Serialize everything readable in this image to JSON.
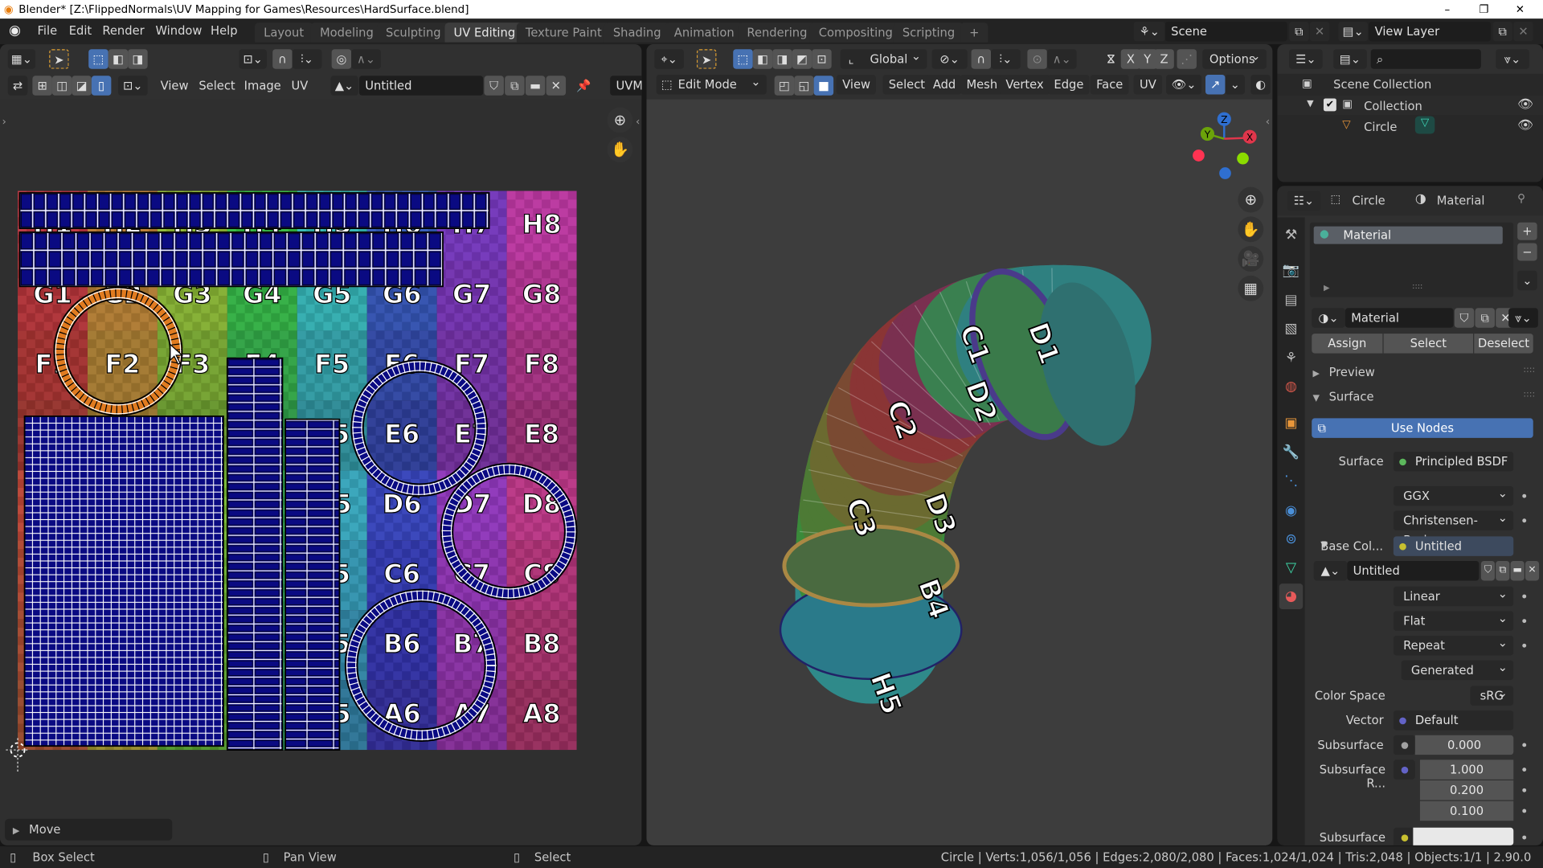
{
  "window": {
    "title": "Blender* [Z:\\FlippedNormals\\UV Mapping for Games\\Resources\\HardSurface.blend]",
    "minimize": "–",
    "maximize": "❐",
    "close": "✕"
  },
  "topbar": {
    "menus": [
      "File",
      "Edit",
      "Render",
      "Window",
      "Help"
    ],
    "tabs": [
      "Layout",
      "Modeling",
      "Sculpting",
      "UV Editing",
      "Texture Paint",
      "Shading",
      "Animation",
      "Rendering",
      "Compositing",
      "Scripting"
    ],
    "active_tab": "UV Editing",
    "add_tab": "+",
    "scene": "Scene",
    "view_layer": "View Layer"
  },
  "uv_editor": {
    "menus": [
      "View",
      "Select",
      "Image",
      "UV"
    ],
    "image_name": "Untitled",
    "uvmap_label": "UVMa",
    "uv_grid": {
      "rows": [
        "H",
        "G",
        "F",
        "E",
        "D",
        "C",
        "B",
        "A"
      ],
      "cols": [
        "1",
        "2",
        "3",
        "4",
        "5",
        "6",
        "7",
        "8"
      ]
    },
    "island_color": "#0a0a82",
    "selected_island_color": "#e07b20",
    "last_operator": "Move"
  },
  "viewport": {
    "orientation": "Global",
    "options": "Options",
    "mode": "Edit Mode",
    "menus": [
      "View",
      "Select",
      "Add",
      "Mesh",
      "Vertex",
      "Edge",
      "Face",
      "UV"
    ],
    "axes": {
      "x": "X",
      "y": "Y",
      "z": "Z"
    },
    "pipe_labels": [
      "C1",
      "D1",
      "C2",
      "D2",
      "C3",
      "D3",
      "B4",
      "H5"
    ]
  },
  "outliner": {
    "scene_collection": "Scene Collection",
    "collection": "Collection",
    "object": "Circle"
  },
  "properties": {
    "object": "Circle",
    "context": "Material",
    "slot": "Material",
    "material_name": "Material",
    "assign": "Assign",
    "select": "Select",
    "deselect": "Deselect",
    "preview": "Preview",
    "surface_panel": "Surface",
    "use_nodes": "Use Nodes",
    "surface_label": "Surface",
    "surface_value": "Principled BSDF",
    "distribution": "GGX",
    "subsurface_method": "Christensen-Burley",
    "base_color_label": "Base Col...",
    "base_color_value": "Untitled",
    "image_name": "Untitled",
    "interpolation": "Linear",
    "projection": "Flat",
    "extension": "Repeat",
    "source": "Generated",
    "color_space_label": "Color Space",
    "color_space": "sRG",
    "vector_label": "Vector",
    "vector_value": "Default",
    "subsurface_label": "Subsurface",
    "subsurface_value": "0.000",
    "subsurface_radius_label": "Subsurface R...",
    "subsurface_radius": [
      "1.000",
      "0.200",
      "0.100"
    ],
    "subsurface_color_label": "Subsurface C...",
    "accent": "#4772b3"
  },
  "statusbar": {
    "left_click": "Box Select",
    "middle_click": "Pan View",
    "right_click": "Select",
    "stats": "Circle | Verts:1,056/1,056 | Edges:2,080/2,080 | Faces:1,024/1,024 | Tris:2,048 | Objects:1/1 | 2.90.0"
  }
}
